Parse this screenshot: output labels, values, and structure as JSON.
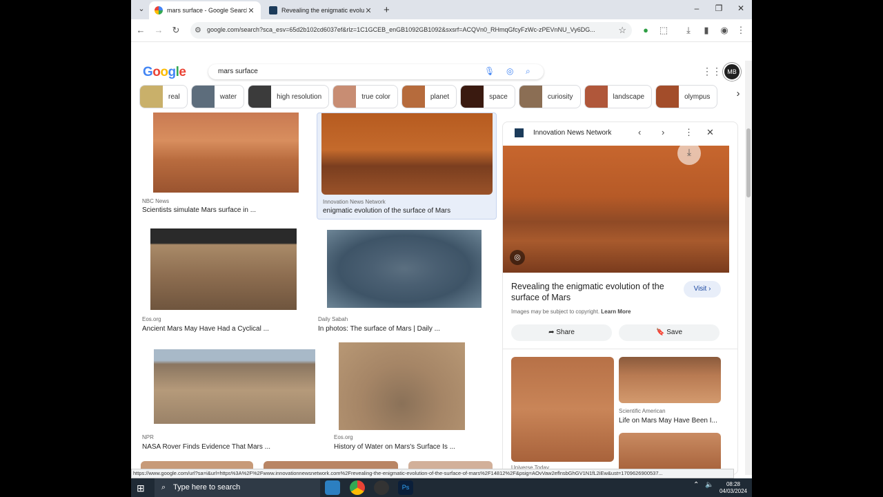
{
  "browser": {
    "tabs": [
      {
        "title": "mars surface - Google Search",
        "active": true
      },
      {
        "title": "Revealing the enigmatic evoluti",
        "active": false
      }
    ],
    "new_tab": "+",
    "url": "google.com/search?sca_esv=65d2b102cd6037ef&rlz=1C1GCEB_enGB1092GB1092&sxsrf=ACQVn0_RHmqGfcyFzWc-zPEVnNU_Vy6DG...",
    "status_url": "https://www.google.com/url?sa=i&url=https%3A%2F%2Fwww.innovationnewsnetwork.com%2Frevealing-the-enigmatic-evolution-of-the-surface-of-mars%2F14812%2F&psig=AOvVaw2eflnsbGhGV1N1fL2iEw&ust=1709626900537..."
  },
  "search": {
    "logo": "Google",
    "query": "mars surface",
    "avatar": "MB"
  },
  "chips": [
    {
      "label": "real",
      "color": "#c9b06a"
    },
    {
      "label": "water",
      "color": "#5d6d7c"
    },
    {
      "label": "high resolution",
      "color": "#3b3b3b"
    },
    {
      "label": "true color",
      "color": "#c88d73"
    },
    {
      "label": "planet",
      "color": "#b66b3c"
    },
    {
      "label": "space",
      "color": "#3a1a10"
    },
    {
      "label": "curiosity",
      "color": "#8b6e54"
    },
    {
      "label": "landscape",
      "color": "#b0573a"
    },
    {
      "label": "olympus",
      "color": "#a34d2a"
    }
  ],
  "results": [
    {
      "source": "NBC News",
      "title": "Scientists simulate Mars surface in ..."
    },
    {
      "source": "Innovation News Network",
      "title": "enigmatic evolution of the surface of Mars"
    },
    {
      "source": "Eos.org",
      "title": "Ancient Mars May Have Had a Cyclical ..."
    },
    {
      "source": "Daily Sabah",
      "title": "In photos: The surface of Mars | Daily ..."
    },
    {
      "source": "NPR",
      "title": "NASA Rover Finds Evidence That Mars ..."
    },
    {
      "source": "Eos.org",
      "title": "History of Water on Mars's Surface Is ..."
    }
  ],
  "panel": {
    "source": "Innovation News Network",
    "title": "Revealing the enigmatic evolution of the surface of Mars",
    "visit_label": "Visit",
    "copyright": "Images may be subject to copyright.",
    "learn_more": "Learn More",
    "share_label": "Share",
    "save_label": "Save",
    "related": [
      {
        "source": "Scientific American",
        "title": "Life on Mars May Have Been I..."
      },
      {
        "source": "Universe Today",
        "title": ""
      }
    ]
  },
  "taskbar": {
    "search_placeholder": "Type here to search",
    "time": "08:28",
    "date": "04/03/2024"
  }
}
